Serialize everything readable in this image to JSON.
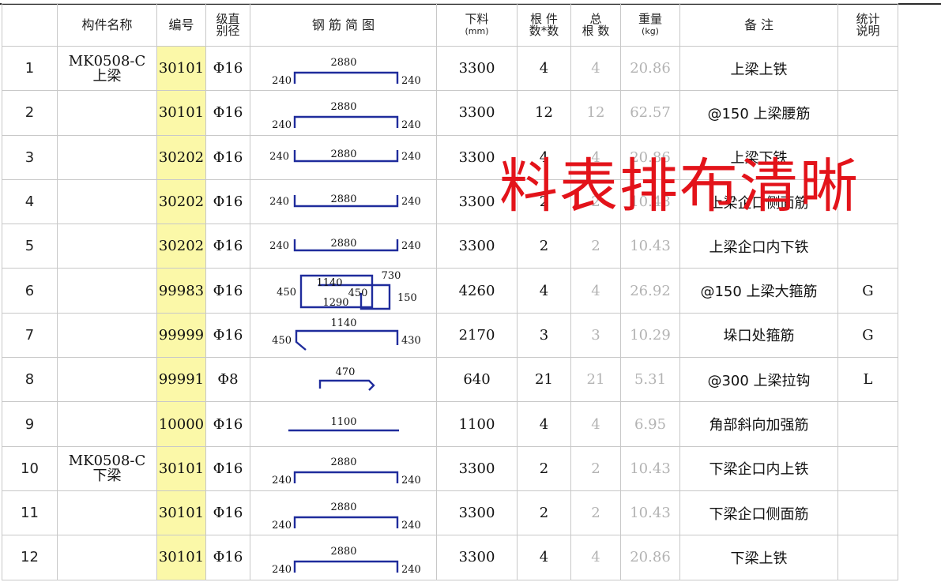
{
  "headers": {
    "seq": "",
    "name": "构件名称",
    "code": "编号",
    "grade_l1": "级直",
    "grade_l2": "别径",
    "shape": "钢 筋 简 图",
    "cut_l1": "下料",
    "cut_unit": "(mm)",
    "count_l1": "根 件",
    "count_l2": "数*数",
    "total_l1": "总",
    "total_l2": "根 数",
    "weight_l1": "重量",
    "weight_unit": "(kg)",
    "remark": "备      注",
    "stat_l1": "统计",
    "stat_l2": "说明"
  },
  "rows": [
    {
      "seq": "1",
      "name_l1": "MK0508-C",
      "name_l2": "上梁",
      "code": "30101",
      "grade": "Φ16",
      "shape_type": "hook-down",
      "dims": {
        "a": "240",
        "b": "2880",
        "c": "240"
      },
      "cut": "3300",
      "count": "4",
      "total": "4",
      "weight": "20.86",
      "remark": "上梁上铁",
      "stat": ""
    },
    {
      "seq": "2",
      "name_l1": "",
      "name_l2": "",
      "code": "30101",
      "grade": "Φ16",
      "shape_type": "hook-down",
      "dims": {
        "a": "240",
        "b": "2880",
        "c": "240"
      },
      "cut": "3300",
      "count": "12",
      "total": "12",
      "weight": "62.57",
      "remark": "@150 上梁腰筋",
      "stat": ""
    },
    {
      "seq": "3",
      "name_l1": "",
      "name_l2": "",
      "code": "30202",
      "grade": "Φ16",
      "shape_type": "hook-up",
      "dims": {
        "a": "240",
        "b": "2880",
        "c": "240"
      },
      "cut": "3300",
      "count": "4",
      "total": "4",
      "weight": "20.86",
      "remark": "上梁下铁",
      "stat": ""
    },
    {
      "seq": "4",
      "name_l1": "",
      "name_l2": "",
      "code": "30202",
      "grade": "Φ16",
      "shape_type": "hook-up",
      "dims": {
        "a": "240",
        "b": "2880",
        "c": "240"
      },
      "cut": "3300",
      "count": "2",
      "total": "2",
      "weight": "10.43",
      "remark": "上梁企口侧面筋",
      "stat": ""
    },
    {
      "seq": "5",
      "name_l1": "",
      "name_l2": "",
      "code": "30202",
      "grade": "Φ16",
      "shape_type": "hook-up",
      "dims": {
        "a": "240",
        "b": "2880",
        "c": "240"
      },
      "cut": "3300",
      "count": "2",
      "total": "2",
      "weight": "10.43",
      "remark": "上梁企口内下铁",
      "stat": ""
    },
    {
      "seq": "6",
      "name_l1": "",
      "name_l2": "",
      "code": "99983",
      "grade": "Φ16",
      "shape_type": "stirrup-large",
      "dims": {
        "a": "1140",
        "b": "730",
        "c": "450",
        "d": "450",
        "e": "1290",
        "f": "150"
      },
      "cut": "4260",
      "count": "4",
      "total": "4",
      "weight": "26.92",
      "remark": "@150 上梁大箍筋",
      "stat": "G"
    },
    {
      "seq": "7",
      "name_l1": "",
      "name_l2": "",
      "code": "99999",
      "grade": "Φ16",
      "shape_type": "stirrup-open",
      "dims": {
        "a": "450",
        "b": "1140",
        "c": "430"
      },
      "cut": "2170",
      "count": "3",
      "total": "3",
      "weight": "10.29",
      "remark": "垛口处箍筋",
      "stat": "G"
    },
    {
      "seq": "8",
      "name_l1": "",
      "name_l2": "",
      "code": "99991",
      "grade": "Φ8",
      "shape_type": "tie",
      "dims": {
        "b": "470"
      },
      "cut": "640",
      "count": "21",
      "total": "21",
      "weight": "5.31",
      "remark": "@300 上梁拉钩",
      "stat": "L"
    },
    {
      "seq": "9",
      "name_l1": "",
      "name_l2": "",
      "code": "10000",
      "grade": "Φ16",
      "shape_type": "straight",
      "dims": {
        "b": "1100"
      },
      "cut": "1100",
      "count": "4",
      "total": "4",
      "weight": "6.95",
      "remark": "角部斜向加强筋",
      "stat": ""
    },
    {
      "seq": "10",
      "name_l1": "MK0508-C",
      "name_l2": "下梁",
      "code": "30101",
      "grade": "Φ16",
      "shape_type": "hook-down",
      "dims": {
        "a": "240",
        "b": "2880",
        "c": "240"
      },
      "cut": "3300",
      "count": "2",
      "total": "2",
      "weight": "10.43",
      "remark": "下梁企口内上铁",
      "stat": ""
    },
    {
      "seq": "11",
      "name_l1": "",
      "name_l2": "",
      "code": "30101",
      "grade": "Φ16",
      "shape_type": "hook-down",
      "dims": {
        "a": "240",
        "b": "2880",
        "c": "240"
      },
      "cut": "3300",
      "count": "2",
      "total": "2",
      "weight": "10.43",
      "remark": "下梁企口侧面筋",
      "stat": ""
    },
    {
      "seq": "12",
      "name_l1": "",
      "name_l2": "",
      "code": "30101",
      "grade": "Φ16",
      "shape_type": "hook-down",
      "dims": {
        "a": "240",
        "b": "2880",
        "c": "240"
      },
      "cut": "3300",
      "count": "4",
      "total": "4",
      "weight": "20.86",
      "remark": "下梁上铁",
      "stat": ""
    }
  ],
  "overlay_text": "料表排布清晰",
  "colors": {
    "code_highlight": "#fbf8a8",
    "rebar_line": "#1f2c9c",
    "overlay": "#e3131a",
    "muted_value": "#b3b3b3"
  }
}
